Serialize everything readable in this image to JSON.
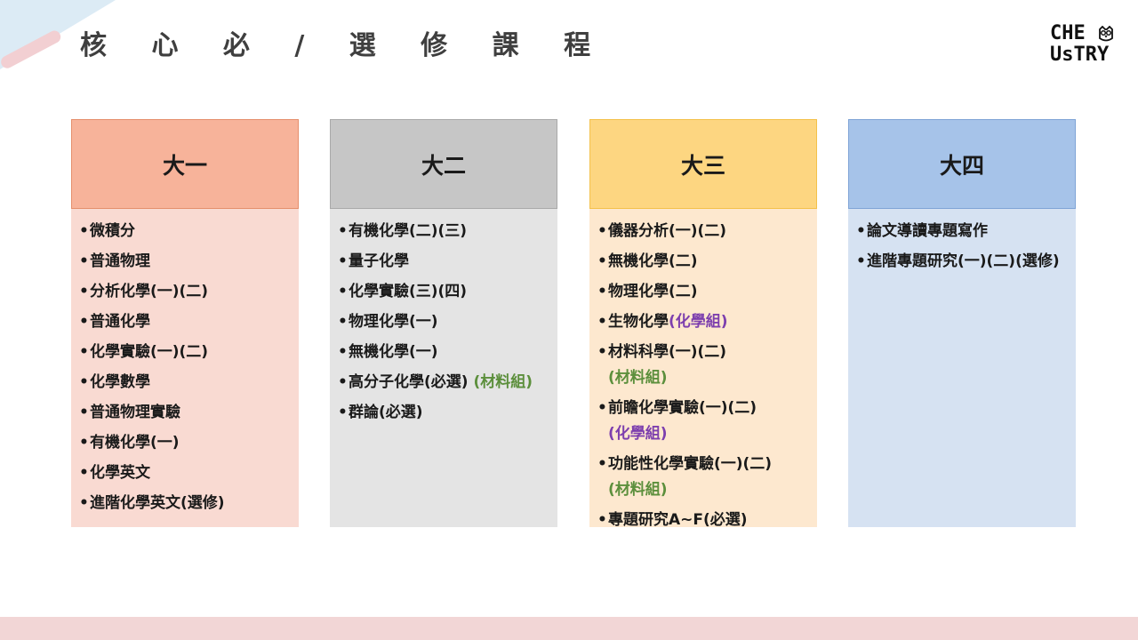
{
  "page": {
    "title": "核 心 必 / 選 修 課 程"
  },
  "logo": {
    "line1": "CHE",
    "line2": "UsTRY",
    "icon": "owl-icon"
  },
  "colors": {
    "col1_head": "#f7b39a",
    "col1_body": "#f9dad2",
    "col2_head": "#c6c6c6",
    "col2_body": "#e4e4e4",
    "col3_head": "#fdd681",
    "col3_body": "#fde8cf",
    "col4_head": "#a6c3e9",
    "col4_body": "#d6e2f2",
    "tag_purple": "#7d3fae",
    "tag_green": "#5c8f3c"
  },
  "columns": [
    {
      "title": "大一",
      "courses": [
        {
          "text": "微積分",
          "tag": ""
        },
        {
          "text": "普通物理",
          "tag": ""
        },
        {
          "text": "分析化學(一)(二)",
          "tag": ""
        },
        {
          "text": "普通化學",
          "tag": ""
        },
        {
          "text": "化學實驗(一)(二)",
          "tag": ""
        },
        {
          "text": "化學數學",
          "tag": ""
        },
        {
          "text": "普通物理實驗",
          "tag": ""
        },
        {
          "text": "有機化學(一)",
          "tag": ""
        },
        {
          "text": "化學英文",
          "tag": ""
        },
        {
          "text": "進階化學英文(選修)",
          "tag": ""
        }
      ]
    },
    {
      "title": "大二",
      "courses": [
        {
          "text": "有機化學(二)(三)",
          "tag": ""
        },
        {
          "text": "量子化學",
          "tag": ""
        },
        {
          "text": "化學實驗(三)(四)",
          "tag": ""
        },
        {
          "text": "物理化學(一)",
          "tag": ""
        },
        {
          "text": "無機化學(一)",
          "tag": ""
        },
        {
          "text": "高分子化學(必選) ",
          "tag": "(材料組)"
        },
        {
          "text": "群論(必選)",
          "tag": ""
        }
      ]
    },
    {
      "title": "大三",
      "courses": [
        {
          "text": "儀器分析(一)(二)",
          "tag": ""
        },
        {
          "text": "無機化學(二)",
          "tag": ""
        },
        {
          "text": "物理化學(二)",
          "tag": ""
        },
        {
          "text": "生物化學",
          "tag": "(化學組)"
        },
        {
          "text": "材料科學(一)(二)",
          "tag": "(材料組)"
        },
        {
          "text": "前瞻化學實驗(一)(二)",
          "tag": "(化學組)"
        },
        {
          "text": "功能性化學實驗(一)(二)",
          "tag": "(材料組)"
        },
        {
          "text": "專題研究A~F(必選)",
          "tag": ""
        }
      ]
    },
    {
      "title": "大四",
      "courses": [
        {
          "text": "論文導讀專題寫作",
          "tag": ""
        },
        {
          "text": "進階專題研究(一)(二)(選修)",
          "tag": ""
        }
      ]
    }
  ]
}
